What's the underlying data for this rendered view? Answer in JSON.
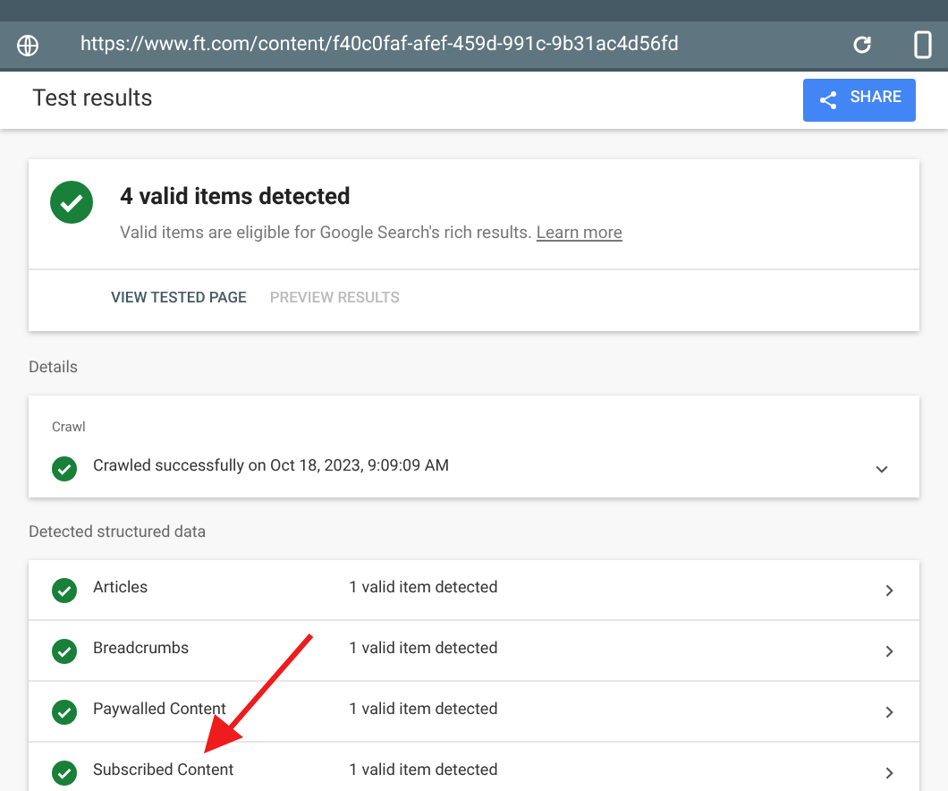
{
  "address_bar": {
    "url": "https://www.ft.com/content/f40c0faf-afef-459d-991c-9b31ac4d56fd"
  },
  "header": {
    "title": "Test results",
    "share_button": "SHARE"
  },
  "summary": {
    "title": "4 valid items detected",
    "description": "Valid items are eligible for Google Search's rich results.",
    "link": "Learn more",
    "actions": [
      {
        "label": "VIEW TESTED PAGE",
        "disabled": false
      },
      {
        "label": "PREVIEW RESULTS",
        "disabled": true
      }
    ]
  },
  "details": {
    "heading": "Details",
    "crawl": {
      "label": "Crawl",
      "status": "Crawled successfully on Oct 18, 2023, 9:09:09 AM",
      "expanded": false
    }
  },
  "structured_data": {
    "heading": "Detected structured data",
    "items": [
      {
        "name": "Articles",
        "result": "1 valid item detected"
      },
      {
        "name": "Breadcrumbs",
        "result": "1 valid item detected"
      },
      {
        "name": "Paywalled Content",
        "result": "1 valid item detected"
      },
      {
        "name": "Subscribed Content",
        "result": "1 valid item detected"
      }
    ]
  }
}
